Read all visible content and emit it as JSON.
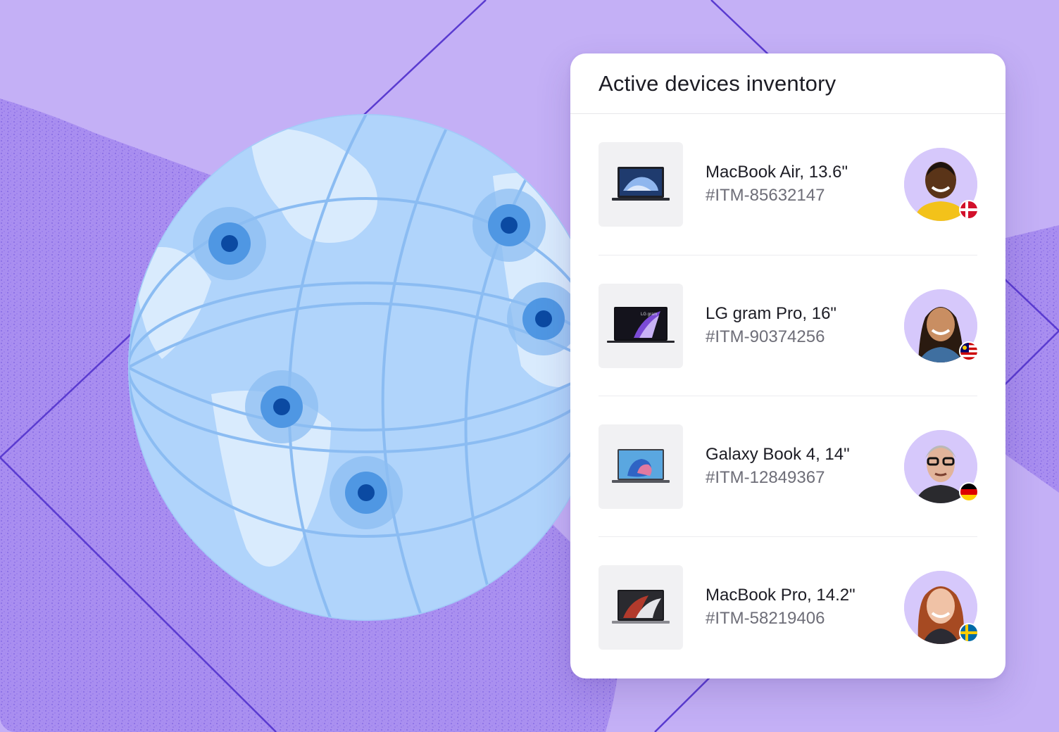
{
  "panel": {
    "title": "Active devices inventory"
  },
  "devices": [
    {
      "name": "MacBook Air, 13.6\"",
      "id": "#ITM-85632147",
      "icon": "laptop-macbook-air-icon",
      "flag": "denmark-flag-icon"
    },
    {
      "name": "LG gram Pro, 16\"",
      "id": "#ITM-90374256",
      "icon": "laptop-lg-gram-icon",
      "flag": "malaysia-flag-icon"
    },
    {
      "name": "Galaxy Book 4, 14\"",
      "id": "#ITM-12849367",
      "icon": "laptop-galaxy-book-icon",
      "flag": "germany-flag-icon"
    },
    {
      "name": "MacBook Pro, 14.2\"",
      "id": "#ITM-58219406",
      "icon": "laptop-macbook-pro-icon",
      "flag": "sweden-flag-icon"
    }
  ],
  "colors": {
    "background": "#c4b0f6",
    "globe": "#b0d4fb",
    "land": "#d9ebfd",
    "marker": "#0b4aa2",
    "card": "#ffffff"
  }
}
